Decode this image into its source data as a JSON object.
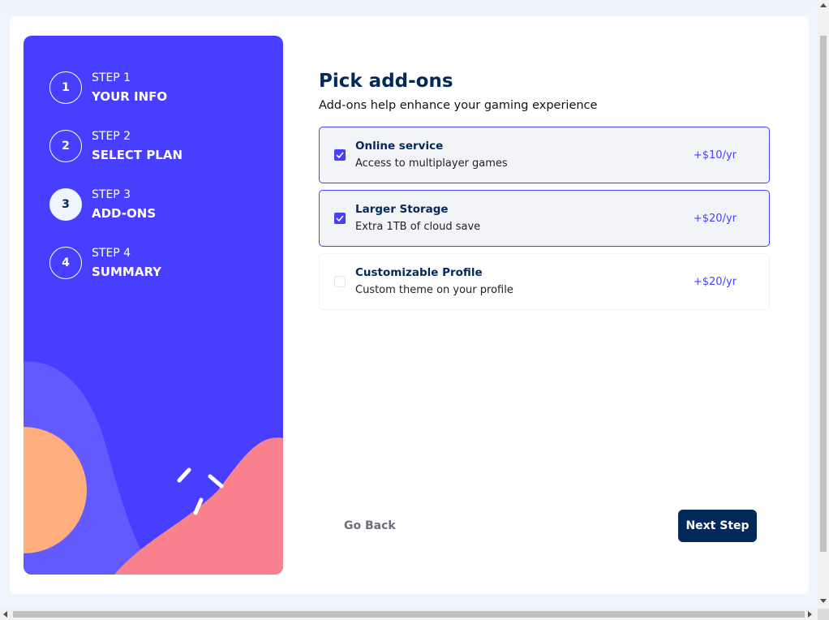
{
  "colors": {
    "page_bg": "#eff5ff",
    "sidebar_bg": "#483eff",
    "accent": "#483eff",
    "marine_blue": "#02295a",
    "selected_bg": "#f2f4f7"
  },
  "sidebar": {
    "steps": [
      {
        "number": "1",
        "label": "STEP 1",
        "name": "YOUR INFO",
        "active": false
      },
      {
        "number": "2",
        "label": "STEP 2",
        "name": "SELECT PLAN",
        "active": false
      },
      {
        "number": "3",
        "label": "STEP 3",
        "name": "ADD-ONS",
        "active": true
      },
      {
        "number": "4",
        "label": "STEP 4",
        "name": "SUMMARY",
        "active": false
      }
    ]
  },
  "main": {
    "title": "Pick add-ons",
    "subtitle": "Add-ons help enhance your gaming experience",
    "addons": [
      {
        "name": "Online service",
        "description": "Access to multiplayer games",
        "price": "+$10/yr",
        "checked": true
      },
      {
        "name": "Larger Storage",
        "description": "Extra 1TB of cloud save",
        "price": "+$20/yr",
        "checked": true
      },
      {
        "name": "Customizable Profile",
        "description": "Custom theme on your profile",
        "price": "+$20/yr",
        "checked": false
      }
    ]
  },
  "footer": {
    "back_label": "Go Back",
    "next_label": "Next Step"
  }
}
